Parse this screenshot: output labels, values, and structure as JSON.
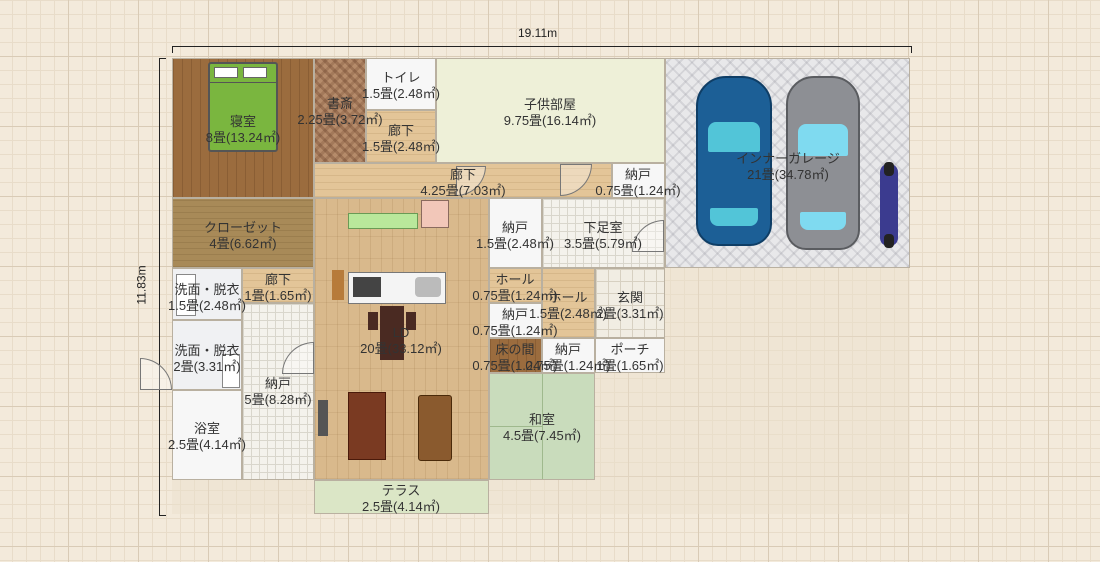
{
  "dimensions": {
    "width_label": "19.11m",
    "height_label": "11.83m"
  },
  "rooms": {
    "bedroom": {
      "name": "寝室",
      "area": "8畳(13.24㎡)"
    },
    "study": {
      "name": "書斎",
      "area": "2.25畳(3.72㎡)"
    },
    "toilet": {
      "name": "トイレ",
      "area": "1.5畳(2.48㎡)"
    },
    "hall_small": {
      "name": "廊下",
      "area": "1.5畳(2.48㎡)"
    },
    "kids_room": {
      "name": "子供部屋",
      "area": "9.75畳(16.14㎡)"
    },
    "garage": {
      "name": "インナーガレージ",
      "area": "21畳(34.78㎡)"
    },
    "hallway": {
      "name": "廊下",
      "area": "4.25畳(7.03㎡)"
    },
    "storage_top": {
      "name": "納戸",
      "area": "0.75畳(1.24㎡)"
    },
    "closet": {
      "name": "クローゼット",
      "area": "4畳(6.62㎡)"
    },
    "storage_mid": {
      "name": "納戸",
      "area": "1.5畳(2.48㎡)"
    },
    "shoe_room": {
      "name": "下足室",
      "area": "3.5畳(5.79㎡)"
    },
    "wash1": {
      "name": "洗面・脱衣",
      "area": "1.5畳(2.48㎡)"
    },
    "hall_left": {
      "name": "廊下",
      "area": "1畳(1.65㎡)"
    },
    "hall_s": {
      "name": "ホール",
      "area": "0.75畳(1.24㎡)"
    },
    "hall_m": {
      "name": "ホール",
      "area": "1.5畳(2.48㎡)"
    },
    "entrance": {
      "name": "玄関",
      "area": "2畳(3.31㎡)"
    },
    "storage_small": {
      "name": "納戸",
      "area": "0.75畳(1.24㎡)"
    },
    "ld": {
      "name": "LD",
      "area": "20畳(33.12㎡)"
    },
    "wash2": {
      "name": "洗面・脱衣",
      "area": "2畳(3.31㎡)"
    },
    "tokonoma": {
      "name": "床の間",
      "area": "0.75畳(1.24㎡)"
    },
    "storage_low": {
      "name": "納戸",
      "area": "0.75畳(1.24㎡)"
    },
    "porch": {
      "name": "ポーチ",
      "area": "1畳(1.65㎡)"
    },
    "storage_big": {
      "name": "納戸",
      "area": "5畳(8.28㎡)"
    },
    "bath": {
      "name": "浴室",
      "area": "2.5畳(4.14㎡)"
    },
    "japanese": {
      "name": "和室",
      "area": "4.5畳(7.45㎡)"
    },
    "terrace": {
      "name": "テラス",
      "area": "2.5畳(4.14㎡)"
    }
  },
  "colors": {
    "car_blue": "#1c5f96",
    "car_gray": "#8d8f94",
    "bike": "#3b3b8f"
  }
}
